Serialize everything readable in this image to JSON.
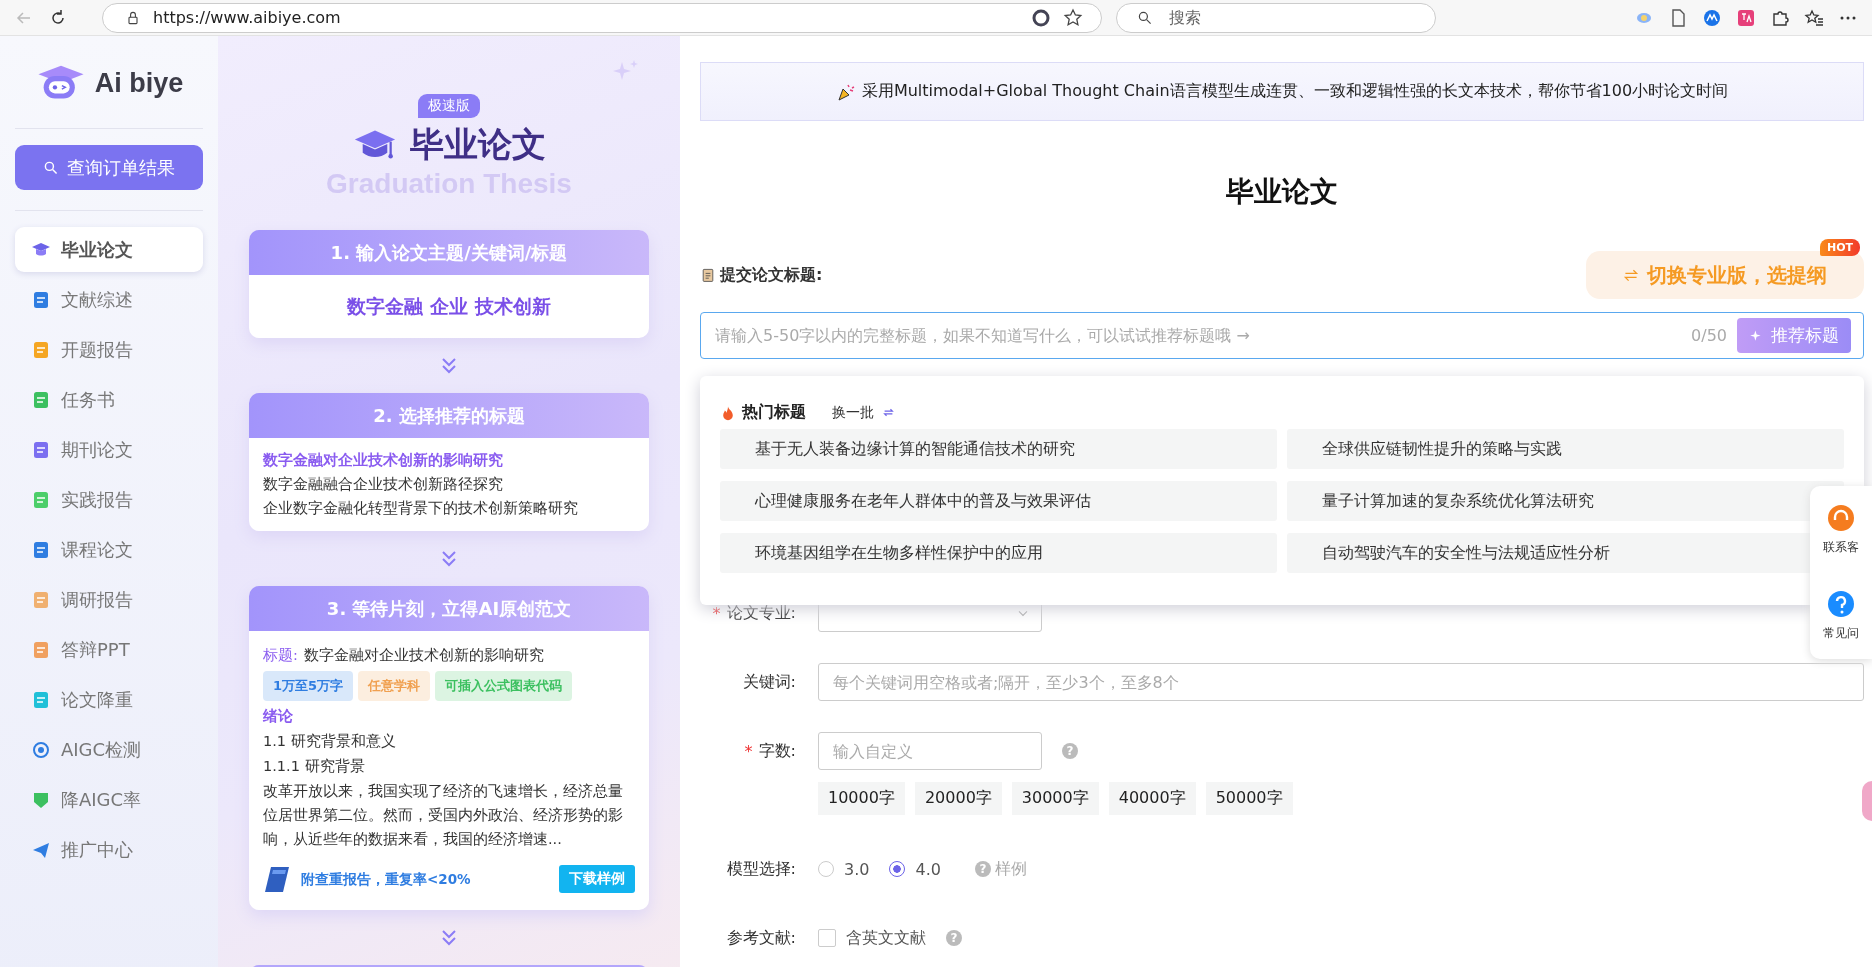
{
  "browser": {
    "url": "https://www.aibiye.com",
    "search_placeholder": "搜索"
  },
  "sidebar": {
    "logo": "Ai biye",
    "query_button": "查询订单结果",
    "items": [
      {
        "label": "毕业论文",
        "selected": true
      },
      {
        "label": "文献综述",
        "selected": false
      },
      {
        "label": "开题报告",
        "selected": false
      },
      {
        "label": "任务书",
        "selected": false
      },
      {
        "label": "期刊论文",
        "selected": false
      },
      {
        "label": "实践报告",
        "selected": false
      },
      {
        "label": "课程论文",
        "selected": false
      },
      {
        "label": "调研报告",
        "selected": false
      },
      {
        "label": "答辩PPT",
        "selected": false
      },
      {
        "label": "论文降重",
        "selected": false
      },
      {
        "label": "AIGC检测",
        "selected": false
      },
      {
        "label": "降AIGC率",
        "selected": false
      },
      {
        "label": "推广中心",
        "selected": false
      }
    ]
  },
  "guide": {
    "badge": "极速版",
    "title": "毕业论文",
    "subtitle": "Graduation Thesis",
    "steps": [
      {
        "kind": "keywords",
        "heading": "1. 输入论文主题/关键词/标题",
        "keywords": "数字金融 企业 技术创新"
      },
      {
        "kind": "titles",
        "heading": "2. 选择推荐的标题",
        "titles": [
          {
            "text": "数字金融对企业技术创新的影响研究",
            "selected": true
          },
          {
            "text": "数字金融融合企业技术创新路径探究",
            "selected": false
          },
          {
            "text": "企业数字金融化转型背景下的技术创新策略研究",
            "selected": false
          }
        ]
      },
      {
        "kind": "sample",
        "heading": "3. 等待片刻，立得AI原创范文",
        "label": "标题:",
        "title_text": "数字金融对企业技术创新的影响研究",
        "tags": [
          {
            "text": "1万至5万字",
            "color": "#2f7de1"
          },
          {
            "text": "任意学科",
            "color": "#f0a050"
          },
          {
            "text": "可插入公式图表代码",
            "color": "#3cc060"
          }
        ],
        "section": "绪论",
        "lines": [
          "1.1 研究背景和意义",
          "1.1.1 研究背景"
        ],
        "paragraph": "改革开放以来，我国实现了经济的飞速增长，经济总量位居世界第二位。然而，受国内外政治、经济形势的影响，从近些年的数据来看，我国的经济增速...",
        "report": "附查重报告，重复率<20%",
        "download": "下载样例"
      },
      {
        "kind": "more"
      }
    ]
  },
  "main": {
    "banner": "采用Multimodal+Global Thought Chain语言模型生成连贯、一致和逻辑性强的长文本技术，帮你节省100小时论文时间",
    "title": "毕业论文",
    "submit_label": "提交论文标题:",
    "switch_button": "切换专业版，选提纲",
    "hot_badge": "HOT",
    "title_input": {
      "placeholder": "请输入5-50字以内的完整标题，如果不知道写什么，可以试试推荐标题哦 →",
      "counter": "0/50",
      "button": "推荐标题"
    },
    "hot_topics": {
      "title": "热门标题",
      "refresh": "换一批",
      "items": [
        "基于无人装备边缘计算的智能通信技术的研究",
        "全球供应链韧性提升的策略与实践",
        "心理健康服务在老年人群体中的普及与效果评估",
        "量子计算加速的复杂系统优化算法研究",
        "环境基因组学在生物多样性保护中的应用",
        "自动驾驶汽车的安全性与法规适应性分析"
      ]
    },
    "form": [
      {
        "kind": "select",
        "label": "论文专业:",
        "required_mark": "*"
      },
      {
        "kind": "text",
        "label": "关键词:",
        "placeholder": "每个关键词用空格或者;隔开，至少3个，至多8个"
      },
      {
        "kind": "words",
        "label": "字数:",
        "required_mark": "*",
        "placeholder": "输入自定义",
        "help": "?",
        "chips": [
          "10000字",
          "20000字",
          "30000字",
          "40000字",
          "50000字"
        ]
      },
      {
        "kind": "radio",
        "label": "模型选择:",
        "options": [
          {
            "label": "3.0",
            "selected": false
          },
          {
            "label": "4.0",
            "selected": true
          }
        ],
        "help": "?",
        "sample": "样例"
      },
      {
        "kind": "checkbox",
        "label": "参考文献:",
        "option": "含英文文献",
        "checked": false,
        "help": "?"
      }
    ]
  },
  "float_panel": [
    "联系客",
    "常见问"
  ]
}
